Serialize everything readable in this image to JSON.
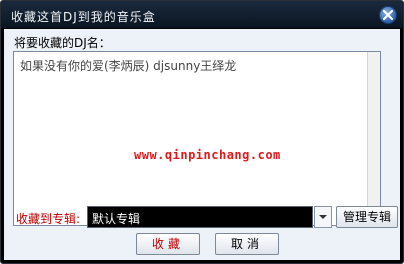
{
  "window": {
    "title": "收藏这首DJ到我的音乐盒",
    "close_icon": "close-icon"
  },
  "form": {
    "dj_label": "将要收藏的DJ名：",
    "song_name": "如果没有你的爱(李炳辰) djsunny王绎龙",
    "watermark": "www.qinpinchang.com",
    "album_label": "收藏到专辑:",
    "album_value": "默认专辑",
    "manage_album_label": "管理专辑"
  },
  "buttons": {
    "collect_label": "收藏",
    "cancel_label": "取消"
  },
  "colors": {
    "title_bar": "#0b1522",
    "client_bg": "#edf1f8",
    "accent_red": "#c00000",
    "watermark_red": "#e0191c"
  }
}
